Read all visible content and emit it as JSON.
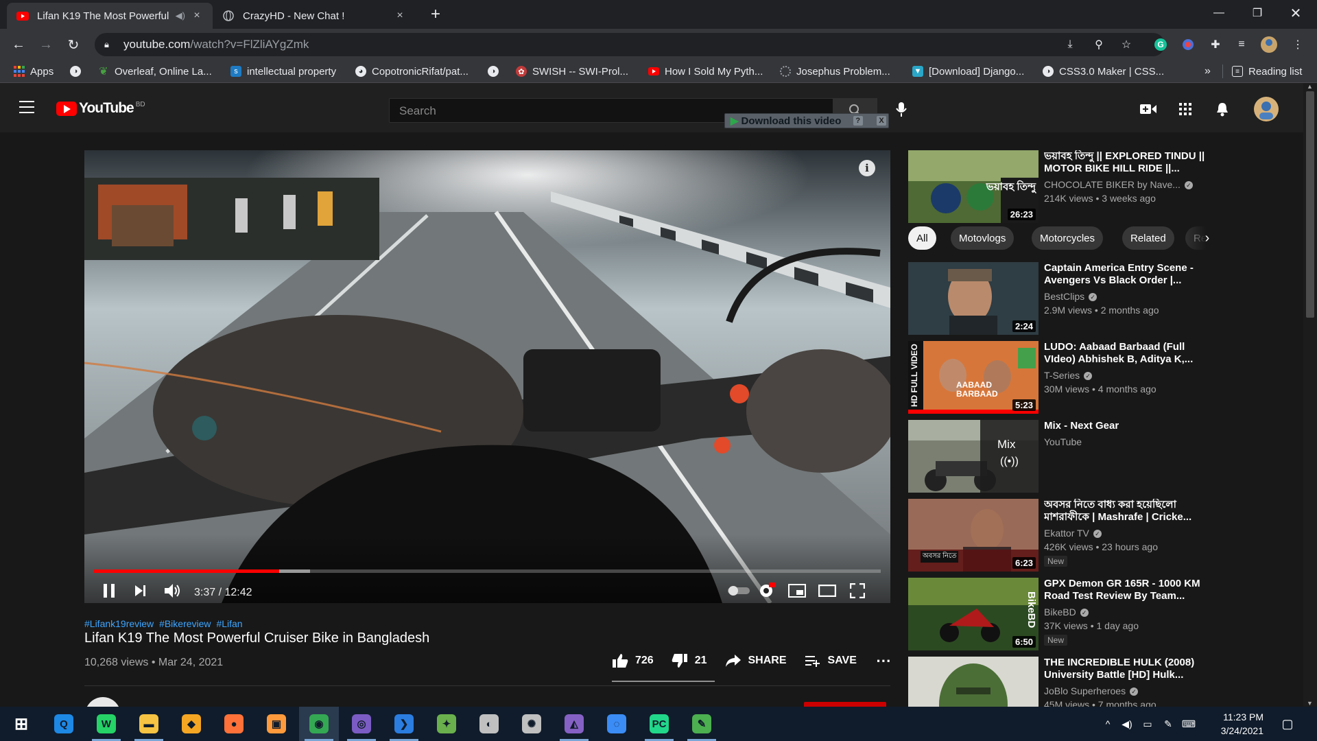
{
  "browser": {
    "tabs": [
      {
        "title": "Lifan K19 The Most Powerful",
        "active": true
      },
      {
        "title": "CrazyHD - New Chat !",
        "active": false
      }
    ],
    "new_tab": "+",
    "close_glyph": "×",
    "url_host": "youtube.com",
    "url_path": "/watch?v=FlZliAYgZmk",
    "bookmarks": [
      {
        "label": "Apps",
        "icon": "apps-grid-icon"
      },
      {
        "label": "",
        "icon": "globe-icon"
      },
      {
        "label": "Overleaf, Online La...",
        "icon": "overleaf-icon"
      },
      {
        "label": "intellectual property",
        "icon": "scribd-icon"
      },
      {
        "label": "CopotronicRifat/pat...",
        "icon": "github-icon"
      },
      {
        "label": "",
        "icon": "globe-icon"
      },
      {
        "label": "SWISH -- SWI-Prol...",
        "icon": "swish-icon"
      },
      {
        "label": "How I Sold My Pyth...",
        "icon": "youtube-icon"
      },
      {
        "label": "Josephus Problem...",
        "icon": "loading-icon"
      },
      {
        "label": "[Download] Django...",
        "icon": "download-site-icon"
      },
      {
        "label": "CSS3.0 Maker | CSS...",
        "icon": "globe-icon"
      }
    ],
    "overflow": "»",
    "reading_list": "Reading list"
  },
  "youtube": {
    "logo_word": "YouTube",
    "country_code": "BD",
    "search_placeholder": "Search",
    "download_badge": "Download this video",
    "download_badge_help": "?",
    "download_badge_close": "X"
  },
  "player": {
    "progress_played": 0.235,
    "progress_buffered": 0.275,
    "current_time": "3:37",
    "duration": "12:42",
    "info_glyph": "i"
  },
  "video": {
    "hashtags": [
      "#Lifank19review",
      "#Bikereview",
      "#Lifan"
    ],
    "title": "Lifan K19 The Most Powerful Cruiser Bike in Bangladesh",
    "views": "10,268 views",
    "date": "Mar 24, 2021",
    "likes": "726",
    "dislikes": "21",
    "share": "SHARE",
    "save": "SAVE"
  },
  "chips": [
    "All",
    "Motovlogs",
    "Motorcycles",
    "Related",
    "Re"
  ],
  "recommendations": [
    {
      "title": "ভয়াবহ তিন্দু || EXPLORED TINDU || MOTOR BIKE HILL RIDE ||...",
      "channel": "CHOCOLATE BIKER by Nave...",
      "verified": true,
      "meta": "214K views • 3 weeks ago",
      "duration": "26:23",
      "new": "",
      "thumb_color": "#5b7a3a",
      "thumb_text": "ভয়াবহ তিন্দু"
    },
    {
      "title": "Captain America Entry Scene - Avengers Vs Black Order |...",
      "channel": "BestClips",
      "verified": true,
      "meta": "2.9M views • 2 months ago",
      "duration": "2:24",
      "new": "",
      "thumb_color": "#3a4a52",
      "thumb_text": ""
    },
    {
      "title": "LUDO: Aabaad Barbaad (Full VIdeo) Abhishek B, Aditya K,...",
      "channel": "T-Series",
      "verified": true,
      "meta": "30M views • 4 months ago",
      "duration": "5:23",
      "new": "",
      "thumb_color": "#c45a2e",
      "thumb_text": "AABAAD BARBAAD"
    },
    {
      "title": "Mix - Next Gear",
      "channel": "YouTube",
      "verified": false,
      "meta": "",
      "duration": "",
      "new": "",
      "thumb_color": "#6a6e60",
      "thumb_text": "Mix"
    },
    {
      "title": "অবসর নিতে বাধ্য করা হয়েছিলো মাশরাফীকে | Mashrafe | Cricke...",
      "channel": "Ekattor TV",
      "verified": true,
      "meta": "426K views • 23 hours ago",
      "duration": "6:23",
      "new": "New",
      "thumb_color": "#8a5040",
      "thumb_text": "অবসর নিতে"
    },
    {
      "title": "GPX Demon GR 165R - 1000 KM Road Test Review By Team...",
      "channel": "BikeBD",
      "verified": true,
      "meta": "37K views • 1 day ago",
      "duration": "6:50",
      "new": "New",
      "thumb_color": "#3c5a2a",
      "thumb_text": "BikeBD"
    },
    {
      "title": "THE INCREDIBLE HULK (2008) University Battle [HD] Hulk...",
      "channel": "JoBlo Superheroes",
      "verified": true,
      "meta": "45M views • 7 months ago",
      "duration": "",
      "new": "",
      "thumb_color": "#4a6a3a",
      "thumb_text": ""
    }
  ],
  "taskbar": {
    "apps": [
      {
        "name": "start",
        "color": "#ffffff",
        "glyph": "⊞"
      },
      {
        "name": "app-q",
        "color": "#1e88e5",
        "glyph": "Q"
      },
      {
        "name": "whatsapp",
        "color": "#25d366",
        "glyph": "W"
      },
      {
        "name": "file-explorer",
        "color": "#f6c342",
        "glyph": "▬"
      },
      {
        "name": "app-shield",
        "color": "#f5a623",
        "glyph": "◆"
      },
      {
        "name": "firefox",
        "color": "#ff7139",
        "glyph": "●"
      },
      {
        "name": "app-orange",
        "color": "#ff9a3c",
        "glyph": "▣"
      },
      {
        "name": "chrome",
        "color": "#34a853",
        "glyph": "◉"
      },
      {
        "name": "github-desktop",
        "color": "#7b5cc4",
        "glyph": "◎"
      },
      {
        "name": "vscode",
        "color": "#2b7de0",
        "glyph": "❯"
      },
      {
        "name": "app-green",
        "color": "#6ab04c",
        "glyph": "✦"
      },
      {
        "name": "app-globe",
        "color": "#c0c0c0",
        "glyph": "◐"
      },
      {
        "name": "app-satellite",
        "color": "#c0c0c0",
        "glyph": "✺"
      },
      {
        "name": "visual-studio",
        "color": "#8661c5",
        "glyph": "◭"
      },
      {
        "name": "messenger",
        "color": "#3b8cf5",
        "glyph": "◌"
      },
      {
        "name": "pycharm",
        "color": "#21d789",
        "glyph": "PC"
      },
      {
        "name": "notepad",
        "color": "#4caf50",
        "glyph": "✎"
      }
    ],
    "time": "11:23 PM",
    "date": "3/24/2021"
  },
  "colors": {
    "yt_red": "#ff0000",
    "link_blue": "#3ea6ff",
    "taskbar": "#101c2b"
  }
}
